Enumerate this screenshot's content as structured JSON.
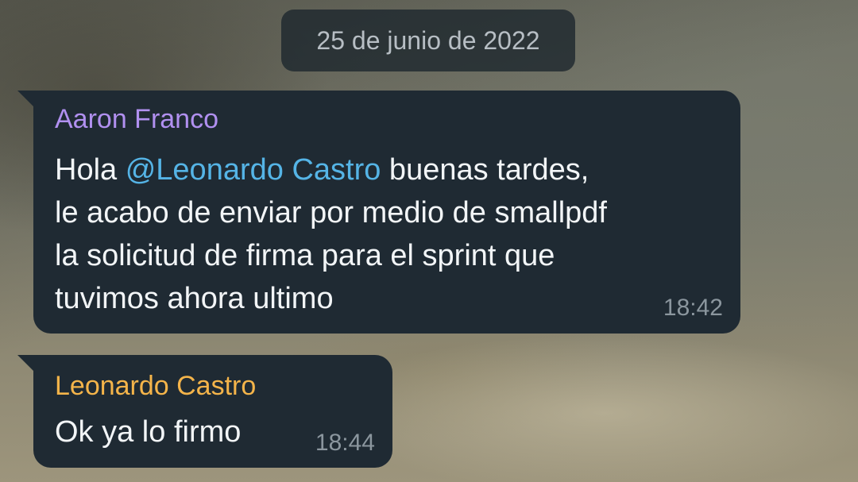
{
  "date_separator": "25 de junio de 2022",
  "messages": [
    {
      "sender": "Aaron Franco",
      "sender_color": "#b190f0",
      "lines": [
        {
          "before": "Hola ",
          "mention": "@Leonardo Castro",
          "after": " buenas tardes,"
        },
        "le acabo de enviar por medio de smallpdf",
        "la solicitud de firma para el sprint que",
        "tuvimos ahora ultimo"
      ],
      "time": "18:42"
    },
    {
      "sender": "Leonardo Castro",
      "sender_color": "#f4b44a",
      "text": "Ok ya lo firmo",
      "time": "18:44"
    }
  ],
  "colors": {
    "bubble": "#1f2a33",
    "mention": "#55b4e6",
    "message_text": "#f2f5f7",
    "timestamp": "#8b969e"
  }
}
